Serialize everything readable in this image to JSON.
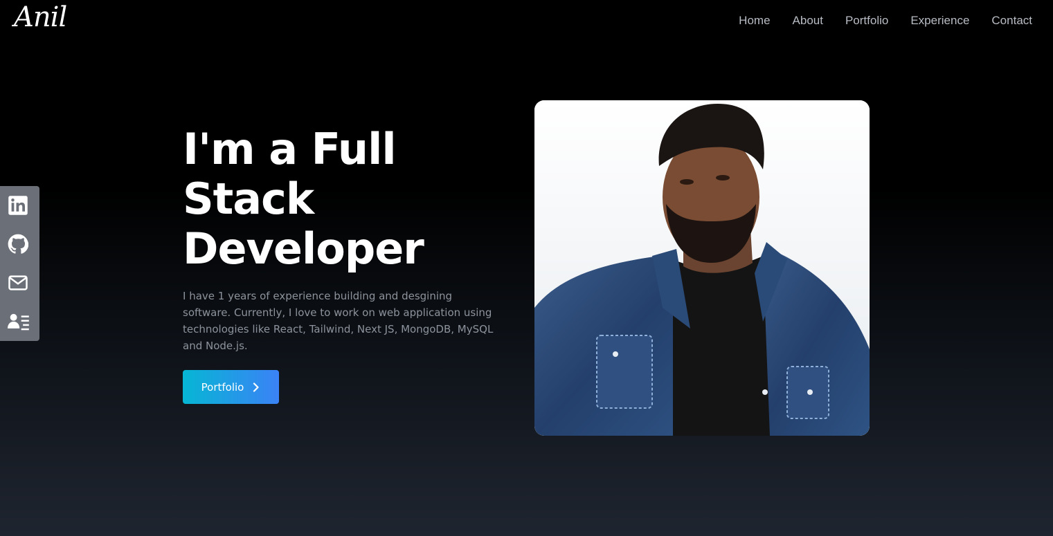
{
  "logo": {
    "text": "Anil"
  },
  "nav": {
    "items": [
      {
        "label": "Home"
      },
      {
        "label": "About"
      },
      {
        "label": "Portfolio"
      },
      {
        "label": "Experience"
      },
      {
        "label": "Contact"
      }
    ]
  },
  "social": {
    "items": [
      {
        "icon": "linkedin-icon"
      },
      {
        "icon": "github-icon"
      },
      {
        "icon": "mail-icon"
      },
      {
        "icon": "resume-icon"
      }
    ]
  },
  "hero": {
    "headline_line1": "I'm a Full",
    "headline_line2": "Stack",
    "headline_line3": "Developer",
    "intro": "I have 1 years of experience building and desgining software. Currently, I love to work on web application using technologies like React, Tailwind, Next JS, MongoDB, MySQL and Node.js.",
    "cta_label": "Portfolio",
    "cta_icon": "chevron-right-icon"
  },
  "colors": {
    "accent_start": "#06b6d4",
    "accent_end": "#3b82f6",
    "social_bar": "#6b6f78"
  }
}
